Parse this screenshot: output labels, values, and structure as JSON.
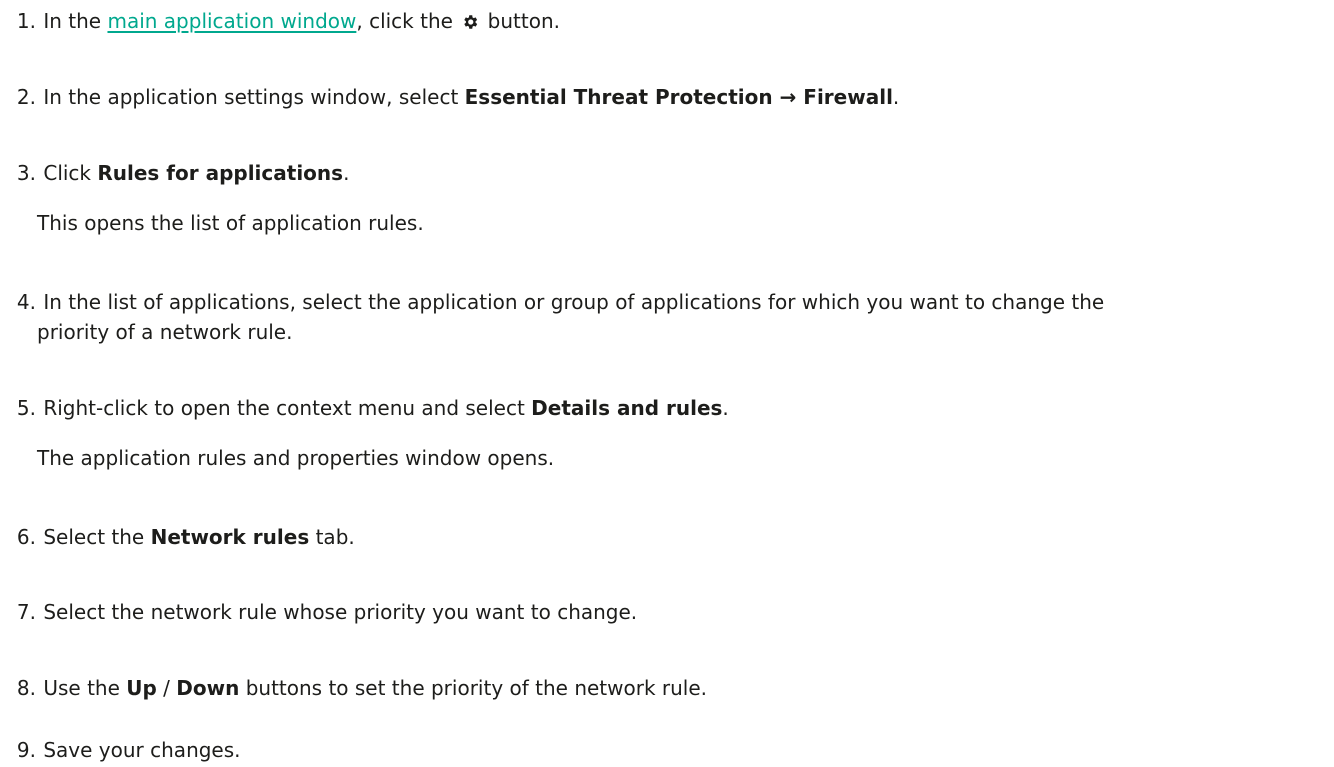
{
  "steps": [
    {
      "num": "1.",
      "before": " In the ",
      "link": "main application window",
      "mid": ", click the ",
      "icon": "gear-icon",
      "after": " button."
    },
    {
      "num": "2.",
      "before": " In the application settings window, select ",
      "bold": "Essential Threat Protection → Firewall",
      "after": "."
    },
    {
      "num": "3.",
      "before": " Click ",
      "bold": "Rules for applications",
      "after": ".",
      "note": "This opens the list of application rules."
    },
    {
      "num": "4.",
      "line1": " In the list of applications, select the application or group of applications for which you want to change the",
      "line2": "priority of a network rule."
    },
    {
      "num": "5.",
      "before": " Right-click to open the context menu and select ",
      "bold": "Details and rules",
      "after": ".",
      "note": "The application rules and properties window opens."
    },
    {
      "num": "6.",
      "before": " Select the ",
      "bold": "Network rules",
      "after": " tab."
    },
    {
      "num": "7.",
      "text": " Select the network rule whose priority you want to change."
    },
    {
      "num": "8.",
      "before": " Use the ",
      "bold1": "Up",
      "sep": " / ",
      "bold2": "Down",
      "after": " buttons to set the priority of the network rule."
    },
    {
      "num": "9.",
      "text": " Save your changes."
    }
  ],
  "colors": {
    "link": "#00a88e",
    "text": "#1d1d1b"
  }
}
